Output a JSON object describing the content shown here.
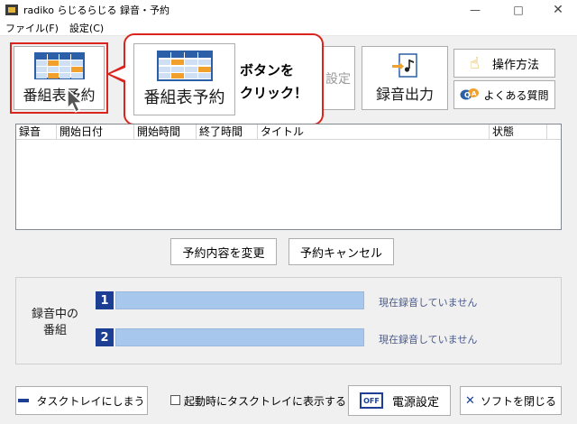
{
  "window": {
    "title": "radiko らじるらじる 録音・予約",
    "min_glyph": "—",
    "max_glyph": "□",
    "close_glyph": "✕"
  },
  "menu": {
    "items": [
      "ファイル(F)",
      "設定(C)"
    ]
  },
  "toolbar": {
    "schedule_label": "番組表予約",
    "hidden_button_partial": "設定",
    "export_label": "録音出力",
    "howto_label": "操作方法",
    "faq_label": "よくある質問"
  },
  "callout": {
    "button_label": "番組表予約",
    "line1": "ボタンを",
    "line2": "クリック！"
  },
  "table": {
    "columns": [
      "録音",
      "開始日付",
      "開始時間",
      "終了時間",
      "タイトル",
      "状態"
    ]
  },
  "actions": {
    "change_label": "予約内容を変更",
    "cancel_label": "予約キャンセル"
  },
  "recording": {
    "label_line1": "録音中の",
    "label_line2": "番組",
    "slots": [
      {
        "num": "1",
        "status": "現在録音していません"
      },
      {
        "num": "2",
        "status": "現在録音していません"
      }
    ]
  },
  "bottom": {
    "tray_label": "タスクトレイにしまう",
    "startup_checkbox_label": "起動時にタスクトレイに表示する",
    "power_icon_text": "OFF",
    "power_label": "電源設定",
    "close_label": "ソフトを閉じる"
  },
  "colors": {
    "accent_red": "#d9251d",
    "slot_blue": "#1c3f94",
    "bar_blue": "#a7c8ec"
  }
}
